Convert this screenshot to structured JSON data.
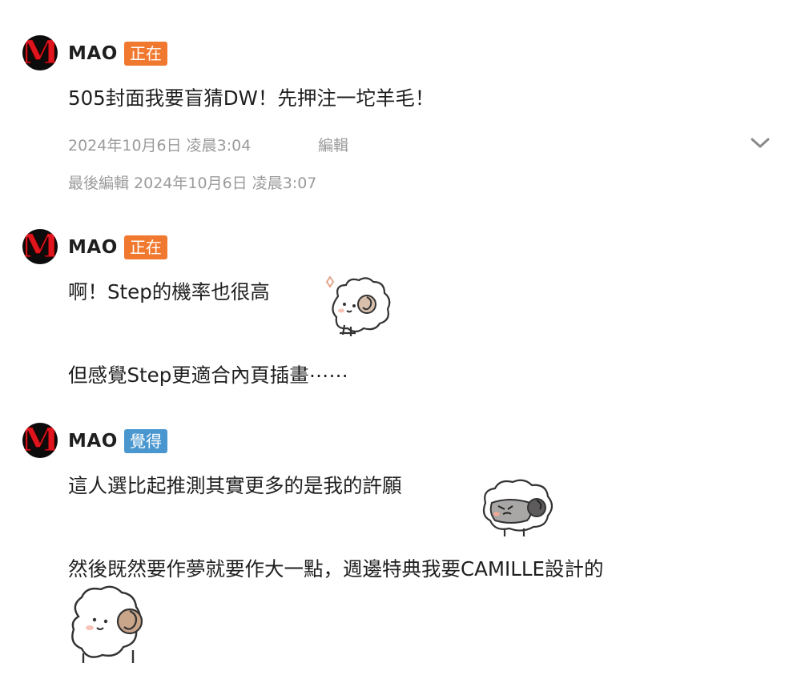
{
  "posts": [
    {
      "author": "MAO",
      "badge": "正在",
      "lines": [
        "505封面我要盲猜DW！先押注一坨羊毛！"
      ],
      "timestamp": "2024年10月6日 凌晨3:04",
      "edit_label": "編輯",
      "last_edited": "最後編輯 2024年10月6日 凌晨3:07"
    },
    {
      "author": "MAO",
      "badge": "正在",
      "lines": [
        "啊！Step的機率也很高",
        "但感覺Step更適合內頁插畫⋯⋯"
      ]
    },
    {
      "author": "MAO",
      "badge": "覺得",
      "lines": [
        "這人選比起推測其實更多的是我的許願",
        "然後既然要作夢就要作大一點，週邊特典我要CAMILLE設計的"
      ]
    }
  ],
  "avatar_letter": "M",
  "icons": {
    "expand": "chevron-down-icon",
    "sticker": "sheep-sticker-icon"
  },
  "colors": {
    "badge_orange": "#f0782f",
    "badge_blue": "#4a97cf",
    "meta_gray": "#9b9b9b",
    "avatar_red": "#e0141c"
  }
}
